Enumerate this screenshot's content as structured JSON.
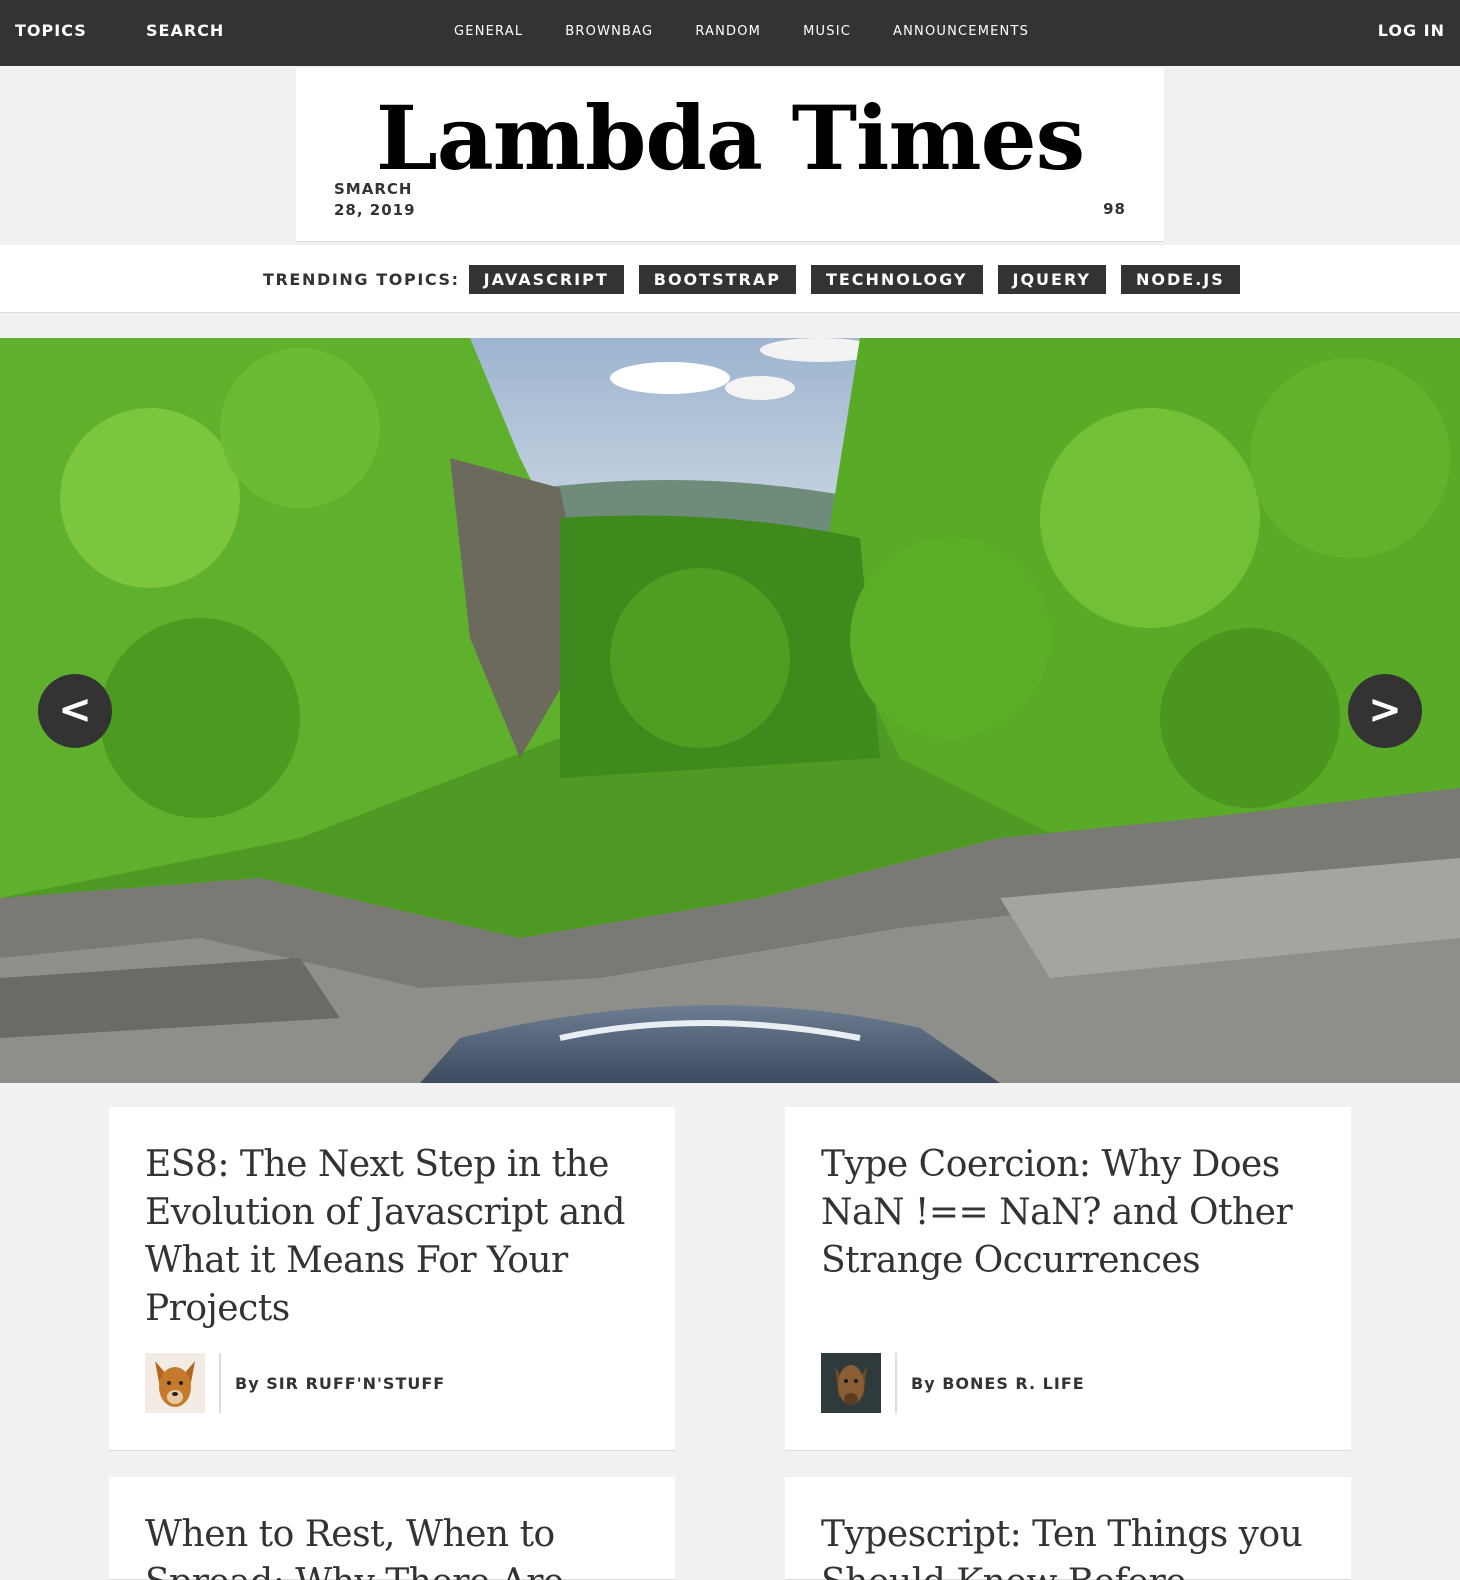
{
  "topbar": {
    "topics": "TOPICS",
    "search": "SEARCH",
    "nav": [
      "GENERAL",
      "BROWNBAG",
      "RANDOM",
      "MUSIC",
      "ANNOUNCEMENTS"
    ],
    "login": "LOG IN"
  },
  "masthead": {
    "title": "Lambda Times",
    "date": "SMARCH 28, 2019",
    "temperature": "98"
  },
  "trending": {
    "label": "TRENDING TOPICS:",
    "topics": [
      "JAVASCRIPT",
      "BOOTSTRAP",
      "TECHNOLOGY",
      "JQUERY",
      "NODE.JS"
    ]
  },
  "carousel": {
    "prev": "<",
    "next": ">",
    "image_alt": "forest-waterfall-photo"
  },
  "cards": [
    {
      "headline": "ES8: The Next Step in the Evolution of Javascript and What it Means For Your Projects",
      "author": "By SIR RUFF'N'STUFF"
    },
    {
      "headline": "Type Coercion: Why Does NaN !== NaN? and Other Strange Occurrences",
      "author": "By BONES R. LIFE"
    },
    {
      "headline": "When to Rest, When to Spread: Why There Are Two Meanings Behind '...'",
      "author": ""
    },
    {
      "headline": "Typescript: Ten Things you Should Know Before Starting",
      "author": ""
    }
  ],
  "colors": {
    "dark": "#333333",
    "background": "#f1f1f1",
    "card": "#ffffff"
  }
}
